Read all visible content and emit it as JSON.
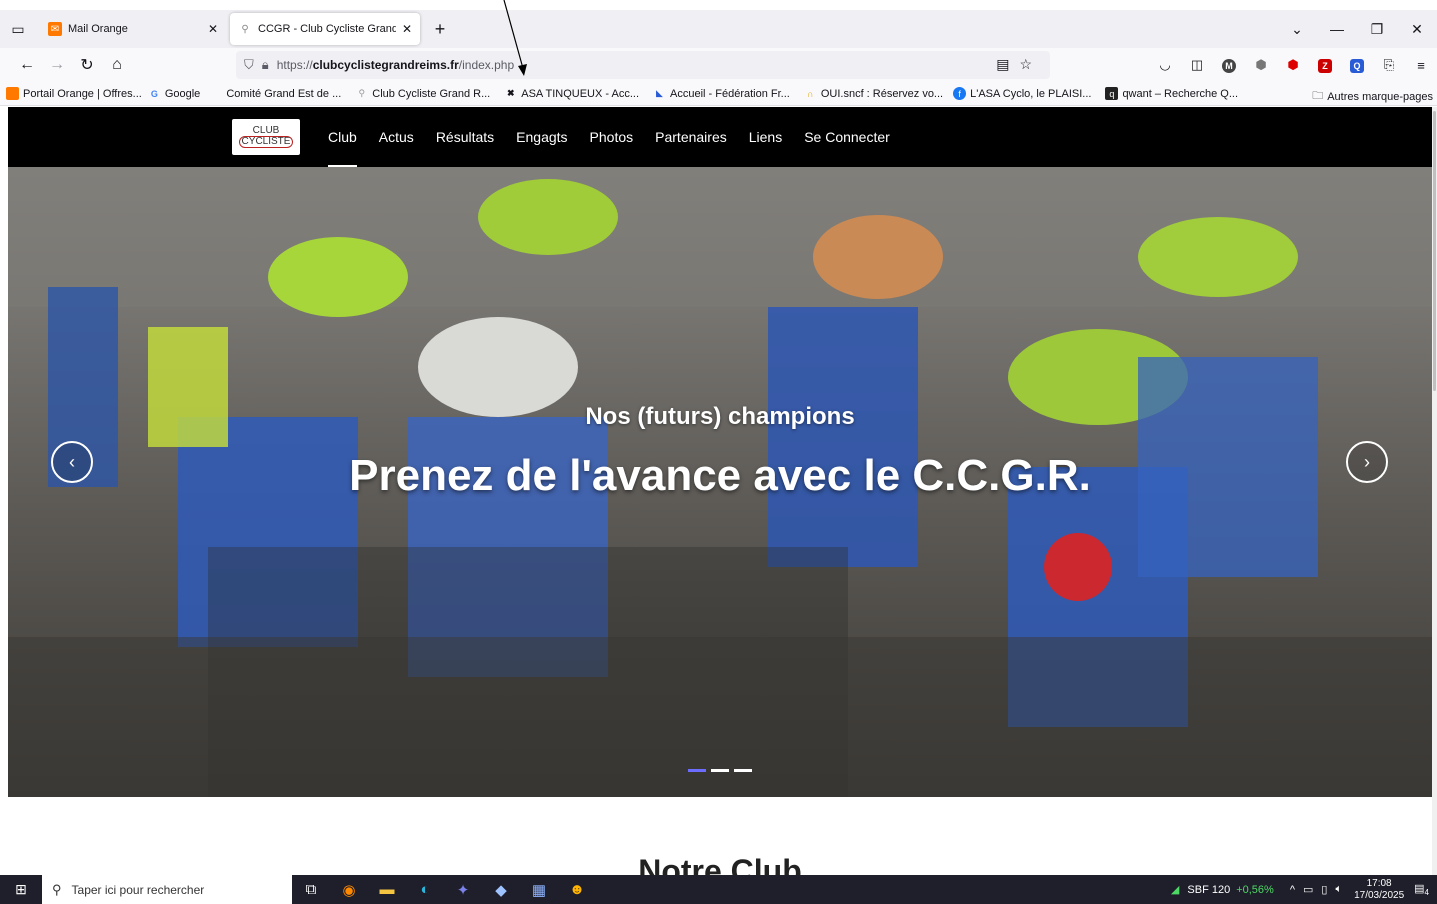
{
  "browser": {
    "tabs": [
      {
        "title": "Mail Orange",
        "active": false
      },
      {
        "title": "CCGR - Club Cycliste Grand Reims",
        "active": true
      }
    ],
    "url": {
      "protocol": "https://",
      "host": "clubcyclistegrandreims.fr",
      "path": "/index.php"
    },
    "bookmarks": [
      "Portail Orange | Offres...",
      "Google",
      "Comité Grand Est de ...",
      "Club Cycliste Grand R...",
      "ASA TINQUEUX - Acc...",
      "Accueil - Fédération Fr...",
      "OUI.sncf : Réservez vo...",
      "L'ASA Cyclo, le PLAISI...",
      "qwant – Recherche Q..."
    ],
    "bookmarks_other": "Autres marque-pages"
  },
  "site": {
    "logo": {
      "line1": "CLUB",
      "line2": "CYCLISTE"
    },
    "menu": [
      "Club",
      "Actus",
      "Résultats",
      "Engagts",
      "Photos",
      "Partenaires",
      "Liens",
      "Se Connecter"
    ],
    "active_menu": "Club",
    "hero": {
      "subtitle": "Nos (futurs) champions",
      "headline": "Prenez de l'avance avec le C.C.G.R."
    },
    "section_title": "Notre Club"
  },
  "taskbar": {
    "search_placeholder": "Taper ici pour rechercher",
    "stock_name": "SBF 120",
    "stock_change": "+0,56%",
    "time": "17:08",
    "date": "17/03/2025",
    "notifications": "4"
  }
}
